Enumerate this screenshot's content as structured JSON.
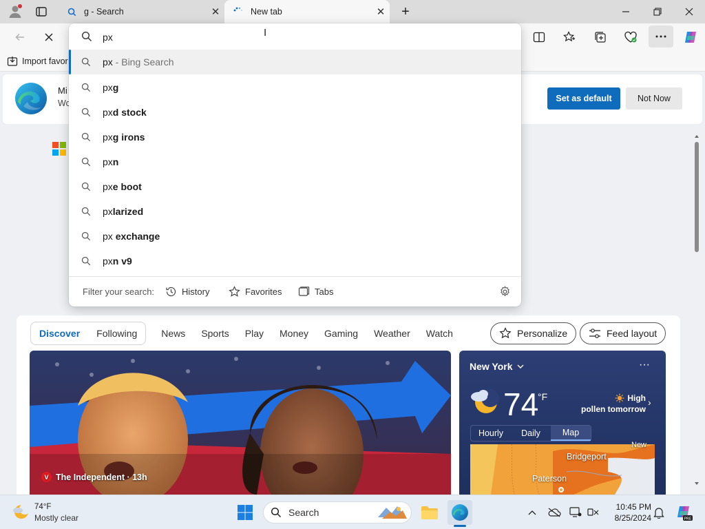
{
  "browser": {
    "tabs": [
      {
        "title": "g - Search",
        "icon": "search-icon"
      },
      {
        "title": "New tab",
        "icon": "loading-icon"
      }
    ],
    "favorites_bar": {
      "import_label": "Import favor"
    },
    "address": {
      "value": "px",
      "suggestions": [
        {
          "prefix": "px",
          "suffix": "",
          "secondary": " - Bing Search"
        },
        {
          "prefix": "px",
          "suffix": "g",
          "secondary": ""
        },
        {
          "prefix": "px",
          "suffix": "d stock",
          "secondary": ""
        },
        {
          "prefix": "px",
          "suffix": "g irons",
          "secondary": ""
        },
        {
          "prefix": "px",
          "suffix": "n",
          "secondary": ""
        },
        {
          "prefix": "px",
          "suffix": "e boot",
          "secondary": ""
        },
        {
          "prefix": "px",
          "suffix": "larized",
          "secondary": ""
        },
        {
          "prefix": "px ",
          "suffix": "exchange",
          "secondary": ""
        },
        {
          "prefix": "px",
          "suffix": "n v9",
          "secondary": ""
        }
      ],
      "filter_label": "Filter your search:",
      "filters": [
        "History",
        "Favorites",
        "Tabs"
      ]
    }
  },
  "banner": {
    "title": "Mi",
    "subtitle": "Wo",
    "set_default_label": "Set as default",
    "not_now_label": "Not Now"
  },
  "feed": {
    "tabs": [
      "Discover",
      "Following"
    ],
    "active_tab": "Discover",
    "nav": [
      "News",
      "Sports",
      "Play",
      "Money",
      "Gaming",
      "Weather",
      "Watch"
    ],
    "personalize_label": "Personalize",
    "layout_label": "Feed layout",
    "news_card": {
      "source": "The Independent · 13h",
      "badge": "V"
    }
  },
  "weather": {
    "city": "New York",
    "temp": "74",
    "unit": "°F",
    "pollen_level": "High",
    "pollen_text": "pollen tomorrow",
    "tabs": [
      "Hourly",
      "Daily",
      "Map"
    ],
    "active_tab": "Map",
    "map_labels": [
      "Bridgeport",
      "Paterson",
      "New"
    ]
  },
  "taskbar": {
    "weather_temp": "74°F",
    "weather_desc": "Mostly clear",
    "search_placeholder": "Search",
    "time": "10:45 PM",
    "date": "8/25/2024"
  },
  "colors": {
    "accent": "#0f6cbd",
    "weather_card": "#2c3e74"
  }
}
